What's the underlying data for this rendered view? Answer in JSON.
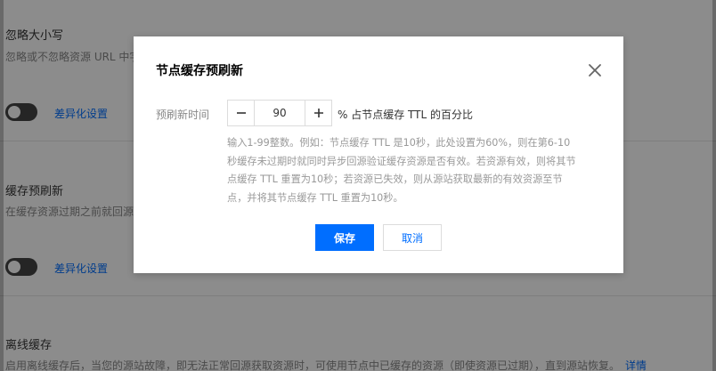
{
  "background": {
    "sections": [
      {
        "title": "忽略大小写",
        "desc": "忽略或不忽略资源 URL 中字",
        "link": "差异化设置"
      },
      {
        "title": "缓存预刷新",
        "desc": "在缓存资源过期之前就回源",
        "link": "差异化设置"
      },
      {
        "title": "离线缓存",
        "desc": "启用离线缓存后，当您的源站故障，即无法正常回源获取资源时，可使用节点中已缓存的资源（即使资源已过期），直到源站恢复。",
        "link": "详情"
      }
    ]
  },
  "dialog": {
    "title": "节点缓存预刷新",
    "close_icon": "close-icon",
    "field_label": "预刷新时间",
    "value": "90",
    "unit_text": "% 占节点缓存 TTL 的百分比",
    "help": "输入1-99整数。例如：节点缓存 TTL 是10秒，此处设置为60%，则在第6-10秒缓存未过期时就同时异步回源验证缓存资源是否有效。若资源有效，则将其节点缓存 TTL 重置为10秒；若资源已失效，则从源站获取最新的有效资源至节点，并将其节点缓存 TTL 重置为10秒。",
    "save_label": "保存",
    "cancel_label": "取消"
  },
  "colors": {
    "primary": "#006eff",
    "overlay": "rgba(0,0,0,0.45)"
  }
}
